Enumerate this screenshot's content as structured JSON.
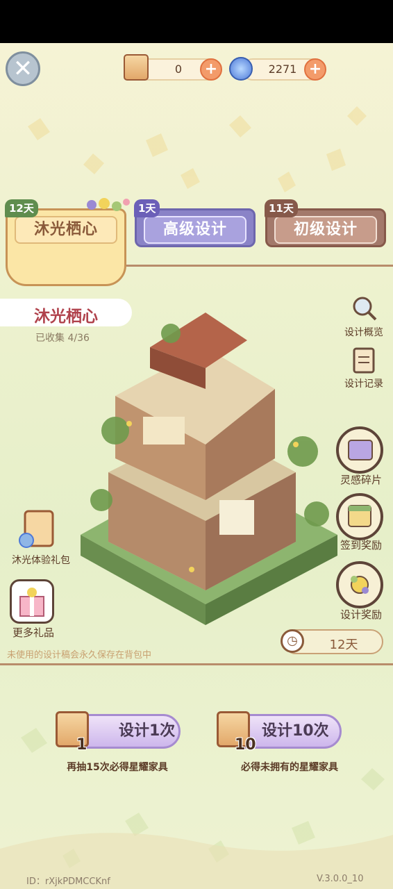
{
  "currency": {
    "tickets": "0",
    "crystals": "2271"
  },
  "tabs": [
    {
      "days": "12天",
      "label": "沐光栖心"
    },
    {
      "days": "1天",
      "label": "高级设计"
    },
    {
      "days": "11天",
      "label": "初级设计"
    }
  ],
  "pool": {
    "title": "沐光栖心",
    "collected": "已收集 4/36"
  },
  "right_menu": {
    "overview": "设计概览",
    "records": "设计记录",
    "inspiration": "灵感碎片",
    "checkin": "签到奖励",
    "design_reward": "设计奖励"
  },
  "left_menu": {
    "trial_pack": "沐光体验礼包",
    "more_gifts": "更多礼品"
  },
  "timer": "12天",
  "notice": "未使用的设计稿会永久保存在背包中",
  "actions": {
    "single": {
      "label": "设计1次",
      "count": "1",
      "hint": "再抽15次必得星耀家具"
    },
    "ten": {
      "label": "设计10次",
      "count": "10",
      "hint": "必得未拥有的星耀家具"
    }
  },
  "footer": {
    "id": "ID：rXjkPDMCCKnf",
    "version": "V.3.0.0_10"
  },
  "colors": {
    "accent_purple": "#8a83c7",
    "accent_brown": "#a3796b",
    "title_red": "#b0424c"
  }
}
